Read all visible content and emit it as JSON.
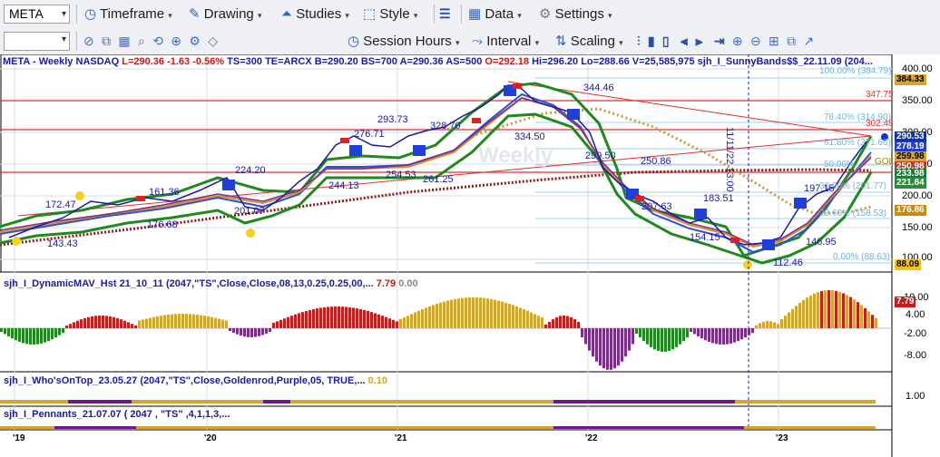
{
  "toolbar": {
    "symbol": "META",
    "menus": [
      "Timeframe",
      "Drawing",
      "Studies",
      "Style",
      "Data",
      "Settings"
    ],
    "row2": [
      "Session Hours",
      "Interval",
      "Scaling"
    ]
  },
  "info": {
    "symbol": "META - Weekly",
    "exchange": "NASDAQ",
    "last": "L=290.36",
    "change": "-1.63",
    "pct": "-0.56%",
    "ts": "TS=300",
    "te": "TE=ARCX",
    "bid": "B=290.20",
    "bs": "BS=700",
    "ask": "A=290.36",
    "as": "AS=500",
    "open": "O=292.18",
    "high": "Hi=296.20",
    "low": "Lo=288.66",
    "volume": "V=25,585,975",
    "study": "sjh_I_SunnyBands$$_22.11.09 (204..."
  },
  "watermark": "Weekly",
  "price_axis": [
    "400.00",
    "350.00",
    "300.00",
    "250.00",
    "200.00",
    "150.00",
    "100.00"
  ],
  "price_badges": [
    {
      "text": "384.33",
      "color": "#d4a531"
    },
    {
      "text": "290.53",
      "color": "#1034a6"
    },
    {
      "text": "278.19",
      "color": "#2540c8"
    },
    {
      "text": "259.98",
      "color": "#d4a531"
    },
    {
      "text": "250.98",
      "color": "#c0392b"
    },
    {
      "text": "233.98",
      "color": "#1f7a3a"
    },
    {
      "text": "221.84",
      "color": "#2b8a3e"
    },
    {
      "text": "176.86",
      "color": "#c48b17"
    },
    {
      "text": "88.09",
      "color": "#f1c40f"
    }
  ],
  "fib_labels": [
    "100.00% (384.79)",
    "76.40% (314.90)",
    "61.80% (271.66)",
    "50.00%",
    "38.20% (201.77)",
    "23.60% (158.53)",
    "0.00% (88.63)"
  ],
  "level_labels": [
    "347.75",
    "302.48",
    "GOL"
  ],
  "price_points": [
    "172.47",
    "143.43",
    "161.36",
    "176.68",
    "224.20",
    "201.07",
    "244.13",
    "276.71",
    "293.73",
    "254.53",
    "261.25",
    "328.70",
    "334.50",
    "344.46",
    "299.50",
    "250.86",
    "207.63",
    "183.51",
    "154.15",
    "197.15",
    "146.95",
    "112.46"
  ],
  "date_label": "11/11/22 13:00",
  "xaxis": [
    "'19",
    "'20",
    "'21",
    "'22",
    "'23"
  ],
  "studies": {
    "mav": {
      "name": "sjh_I_DynamicMAV_Hst 21_10_11 (2047,\"TS\",Close,Close,08,13,0.25,0.25,00,...",
      "v1": "7.79",
      "v2": "0.00",
      "axis": [
        "10.00",
        "4.00",
        "-2.00",
        "-8.00"
      ],
      "badge": "7.79"
    },
    "who": {
      "name": "sjh_I_Who'sOnTop_23.05.27 (2047,\"TS\",Close,Goldenrod,Purple,05,  TRUE,...",
      "v1": "0.10",
      "axis": [
        "1.00"
      ]
    },
    "pennants": {
      "name": "sjh_I_Pennants_21.07.07 ( 2047 , \"TS\" ,4,1,1,3,..."
    }
  },
  "colors": {
    "accent": "#2f63c2",
    "up": "#1a1aa8",
    "down": "#cc1a1a",
    "green": "#1e8a1e",
    "gold": "#d4a531"
  }
}
